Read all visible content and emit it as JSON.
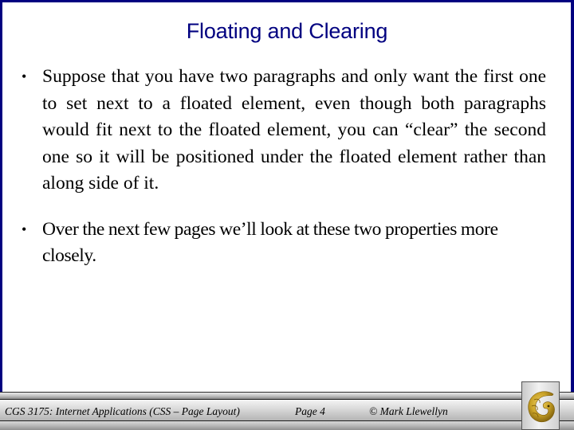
{
  "slide": {
    "title": "Floating and Clearing",
    "bullets": [
      {
        "text": "Suppose that you have two paragraphs and only want the first one to set next to a floated element, even though both paragraphs would fit next to the floated element, you can “clear” the second one so it will be positioned under the floated element rather than along side of it."
      },
      {
        "text": "Over the next few pages we’ll look at these two properties more closely."
      }
    ],
    "bullet_glyph": "•"
  },
  "footer": {
    "course": "CGS 3175: Internet Applications (CSS – Page Layout)",
    "page": "Page 4",
    "copyright": "© Mark Llewellyn",
    "logo": "pegasus-logo-icon"
  },
  "colors": {
    "title": "#000080",
    "border": "#000080",
    "logo_gold": "#c9a227"
  }
}
